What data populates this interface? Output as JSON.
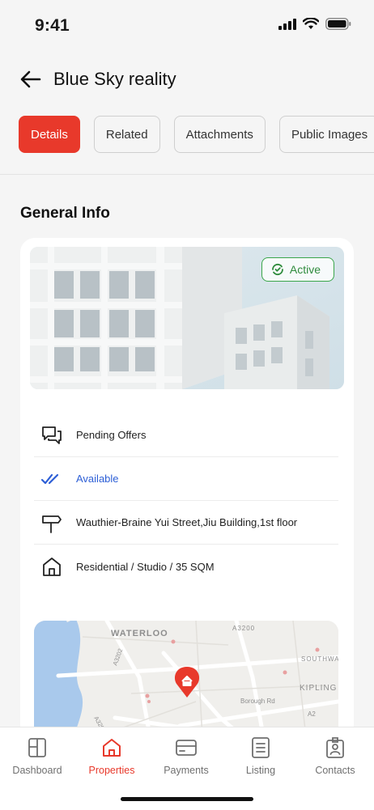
{
  "status_bar": {
    "time": "9:41"
  },
  "header": {
    "title": "Blue Sky reality"
  },
  "tabs": [
    {
      "label": "Details",
      "active": true
    },
    {
      "label": "Related",
      "active": false
    },
    {
      "label": "Attachments",
      "active": false
    },
    {
      "label": "Public Images",
      "active": false
    }
  ],
  "section": {
    "title": "General Info"
  },
  "property": {
    "status_badge": "Active",
    "details": [
      {
        "icon": "chat-bubbles-icon",
        "text": "Pending Offers"
      },
      {
        "icon": "double-check-icon",
        "text": "Available"
      },
      {
        "icon": "signpost-icon",
        "text": "Wauthier-Braine Yui Street,Jiu Building,1st floor"
      },
      {
        "icon": "house-icon",
        "text": "Residential / Studio / 35 SQM"
      }
    ]
  },
  "map": {
    "labels": [
      "WATERLOO",
      "A3200",
      "SOUTHWARK",
      "KIPLING",
      "Borough Rd",
      "A3202",
      "A3203",
      "A2"
    ]
  },
  "bottom_nav": [
    {
      "label": "Dashboard",
      "icon": "dashboard-icon",
      "active": false
    },
    {
      "label": "Properties",
      "icon": "home-icon",
      "active": true
    },
    {
      "label": "Payments",
      "icon": "card-icon",
      "active": false
    },
    {
      "label": "Listing",
      "icon": "list-icon",
      "active": false
    },
    {
      "label": "Contacts",
      "icon": "contact-badge-icon",
      "active": false
    }
  ],
  "colors": {
    "accent": "#e8392b",
    "active_green": "#2e8b3c",
    "available_blue": "#2d5fd6"
  }
}
